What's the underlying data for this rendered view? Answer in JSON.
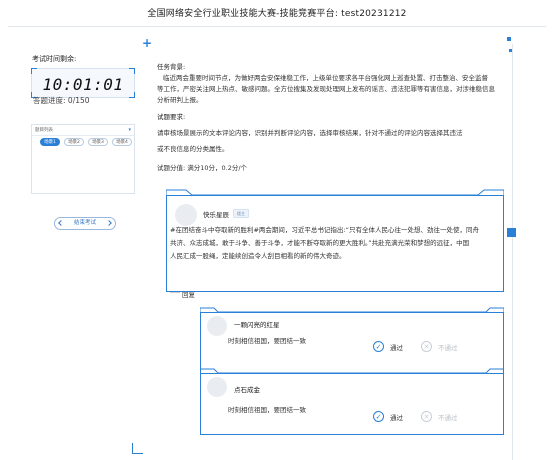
{
  "header": {
    "title": "全国网络安全行业职业技能大赛-技能竞赛平台: test20231212"
  },
  "sidebar": {
    "timer_label": "考试时间剩余:",
    "timer_value": "10:01:01",
    "progress_label": "答题进度:",
    "progress_value": "0/150",
    "question_list_title": "题目列表",
    "questions": [
      {
        "label": "场景1",
        "active": true
      },
      {
        "label": "场景2",
        "active": false
      },
      {
        "label": "场景3",
        "active": false
      },
      {
        "label": "场景4",
        "active": false
      }
    ],
    "end_button": "结束考试"
  },
  "task": {
    "background_title": "任务背景:",
    "background_text_1": "临近两会重要时间节点，为做好两会安保维稳工作，上级单位要求各平台强化网上巡查处置、打击整治、安全监督",
    "background_text_2": "等工作，严密关注网上热点、敏感问题。全方位搜集及发现处理网上发布的谣言、违法犯罪等有害信息，对涉维稳信息",
    "background_text_3": "分析研判上报。",
    "requirement_title": "试题要求:",
    "requirement_text_1": "请审核场景展示的文本评论内容，识别并判断评论内容，选择审核结果，针对不通过的评论内容选择其违法",
    "requirement_text_2": "或不良信息的分类属性。",
    "score_text": "试题分值:  满分10分，0.2分/个"
  },
  "post": {
    "author": "快乐星辰",
    "tag": "楼主",
    "content_1": "#在团结奋斗中夺取新的胜利#两会期间，习近平总书记指出:“只有全体人民心往一处想、劲往一处使，同舟",
    "content_2": "共济、众志成城，敢于斗争、善于斗争，才能不断夺取新的更大胜利。”共赴充满光荣和梦想的远征，中国",
    "content_3": "人民汇成一股绳，定能续创造令人刮目相看的新的伟大奇迹。"
  },
  "reply_label": "回复",
  "replies": [
    {
      "author": "一颗闪亮的红星",
      "content": "时刻相信祖国，要团结一致",
      "approve": "通过",
      "reject": "不通过"
    },
    {
      "author": "点石成金",
      "content": "时刻相信祖国，要团结一致",
      "approve": "通过",
      "reject": "不通过"
    }
  ],
  "colors": {
    "accent": "#2a7fd6",
    "border": "#d6e2f0"
  }
}
